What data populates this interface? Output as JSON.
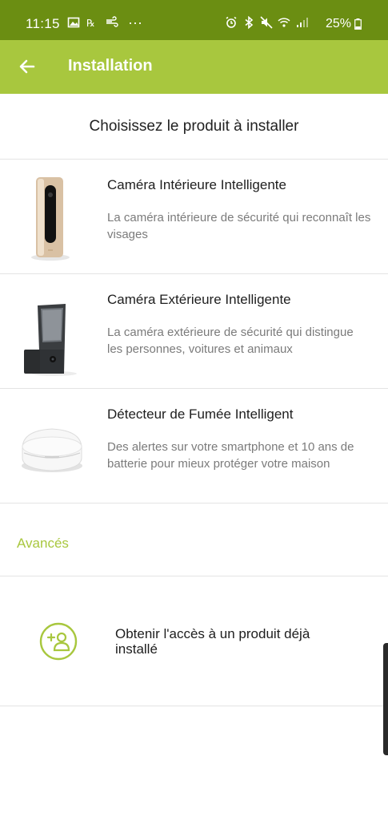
{
  "status_bar": {
    "time": "11:15",
    "battery_percent": "25%",
    "left_icons": [
      "gallery-icon",
      "voicemail-icon",
      "wind-icon",
      "more-dots-icon"
    ],
    "right_icons": [
      "alarm-icon",
      "bluetooth-icon",
      "mute-icon",
      "wifi-icon",
      "signal-icon",
      "battery-icon"
    ],
    "more_dots": "···"
  },
  "app_bar": {
    "title": "Installation",
    "back_icon": "arrow-left-icon",
    "background": "#a8c73e"
  },
  "header": {
    "prompt": "Choisissez le produit à installer"
  },
  "products": [
    {
      "name": "Caméra Intérieure Intelligente",
      "description": "La caméra intérieure de sécurité qui reconnaît les visages",
      "image": "indoor-camera-image"
    },
    {
      "name": "Caméra Extérieure Intelligente",
      "description": "La caméra extérieure de sécurité qui distingue les personnes, voitures et animaux",
      "image": "outdoor-camera-image"
    },
    {
      "name": "Détecteur de Fumée Intelligent",
      "description": "Des alertes sur votre smartphone et 10 ans de batterie pour mieux protéger votre maison",
      "image": "smoke-detector-image"
    }
  ],
  "advanced": {
    "label": "Avancés"
  },
  "access": {
    "label": "Obtenir l'accès à un produit déjà installé",
    "icon": "add-user-icon"
  },
  "colors": {
    "status_bar": "#6b8e12",
    "accent": "#a8c73e",
    "text": "#1e1e1e",
    "secondary_text": "#7b7b7b"
  }
}
